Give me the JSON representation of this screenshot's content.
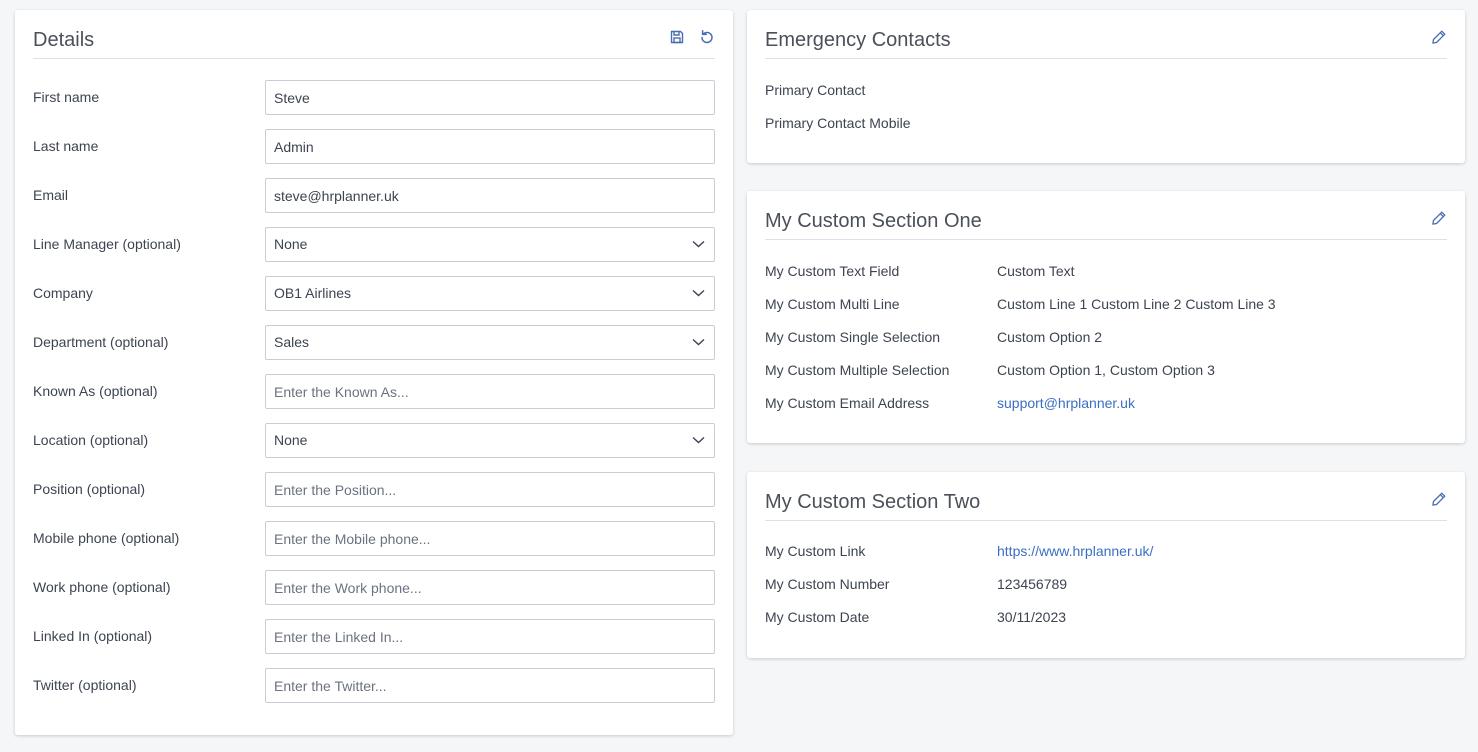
{
  "details": {
    "title": "Details",
    "fields": [
      {
        "label": "First name",
        "type": "input",
        "value": "Steve",
        "placeholder": ""
      },
      {
        "label": "Last name",
        "type": "input",
        "value": "Admin",
        "placeholder": ""
      },
      {
        "label": "Email",
        "type": "input",
        "value": "steve@hrplanner.uk",
        "placeholder": ""
      },
      {
        "label": "Line Manager (optional)",
        "type": "select",
        "value": "None"
      },
      {
        "label": "Company",
        "type": "select",
        "value": "OB1 Airlines"
      },
      {
        "label": "Department (optional)",
        "type": "select",
        "value": "Sales"
      },
      {
        "label": "Known As (optional)",
        "type": "input",
        "value": "",
        "placeholder": "Enter the Known As..."
      },
      {
        "label": "Location (optional)",
        "type": "select",
        "value": "None"
      },
      {
        "label": "Position (optional)",
        "type": "input",
        "value": "",
        "placeholder": "Enter the Position..."
      },
      {
        "label": "Mobile phone (optional)",
        "type": "input",
        "value": "",
        "placeholder": "Enter the Mobile phone..."
      },
      {
        "label": "Work phone (optional)",
        "type": "input",
        "value": "",
        "placeholder": "Enter the Work phone..."
      },
      {
        "label": "Linked In (optional)",
        "type": "input",
        "value": "",
        "placeholder": "Enter the Linked In..."
      },
      {
        "label": "Twitter (optional)",
        "type": "input",
        "value": "",
        "placeholder": "Enter the Twitter..."
      }
    ]
  },
  "emergency": {
    "title": "Emergency Contacts",
    "rows": [
      {
        "label": "Primary Contact",
        "value": ""
      },
      {
        "label": "Primary Contact Mobile",
        "value": ""
      }
    ]
  },
  "section_one": {
    "title": "My Custom Section One",
    "rows": [
      {
        "label": "My Custom Text Field",
        "value": "Custom Text"
      },
      {
        "label": "My Custom Multi Line",
        "value": "Custom Line 1 Custom Line 2 Custom Line 3"
      },
      {
        "label": "My Custom Single Selection",
        "value": "Custom Option 2"
      },
      {
        "label": "My Custom Multiple Selection",
        "value": "Custom Option 1, Custom Option 3"
      },
      {
        "label": "My Custom Email Address",
        "value": "support@hrplanner.uk"
      }
    ]
  },
  "section_two": {
    "title": "My Custom Section Two",
    "rows": [
      {
        "label": "My Custom Link",
        "value": "https://www.hrplanner.uk/"
      },
      {
        "label": "My Custom Number",
        "value": "123456789"
      },
      {
        "label": "My Custom Date",
        "value": "30/11/2023"
      }
    ]
  },
  "icons": {
    "save": "save-icon",
    "reset": "undo-icon",
    "edit": "pencil-icon"
  },
  "colors": {
    "icon": "#4a6cb3",
    "link": "#3a6fc1",
    "background": "#f5f6f8"
  }
}
